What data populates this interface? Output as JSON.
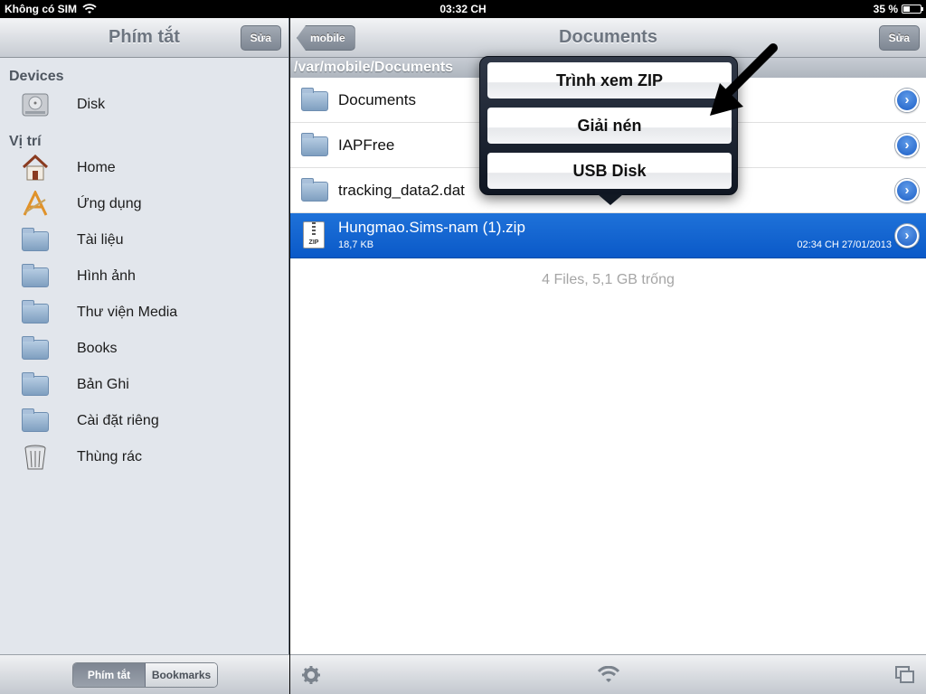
{
  "status_bar": {
    "carrier": "Không có SIM",
    "time": "03:32 CH",
    "battery": "35 %"
  },
  "left_panel": {
    "title": "Phím tắt",
    "edit_label": "Sửa",
    "sections": [
      {
        "header": "Devices",
        "items": [
          {
            "label": "Disk",
            "icon": "disk-icon"
          }
        ]
      },
      {
        "header": "Vị trí",
        "items": [
          {
            "label": "Home",
            "icon": "home-icon"
          },
          {
            "label": "Ứng dụng",
            "icon": "applications-icon"
          },
          {
            "label": "Tài liệu",
            "icon": "documents-folder-icon"
          },
          {
            "label": "Hình ảnh",
            "icon": "pictures-folder-icon"
          },
          {
            "label": "Thư viện Media",
            "icon": "music-folder-icon"
          },
          {
            "label": "Books",
            "icon": "folder-icon"
          },
          {
            "label": "Bản Ghi",
            "icon": "folder-icon"
          },
          {
            "label": "Cài đặt riêng",
            "icon": "folder-icon"
          },
          {
            "label": "Thùng rác",
            "icon": "trash-icon"
          }
        ]
      }
    ],
    "segments": [
      "Phím tắt",
      "Bookmarks"
    ],
    "active_segment": "Phím tắt"
  },
  "right_panel": {
    "back_label": "mobile",
    "title": "Documents",
    "edit_label": "Sửa",
    "path": "/var/mobile/Documents",
    "files": [
      {
        "name": "Documents",
        "type": "folder"
      },
      {
        "name": "IAPFree",
        "type": "folder"
      },
      {
        "name": "tracking_data2.dat",
        "type": "folder"
      },
      {
        "name": "Hungmao.Sims-nam (1).zip",
        "type": "zip",
        "size": "18,7 KB",
        "date": "02:34 CH 27/01/2013",
        "selected": true
      }
    ],
    "summary": "4 Files, 5,1 GB trống"
  },
  "popover": {
    "actions": [
      "Trình xem ZIP",
      "Giải nén",
      "USB Disk"
    ]
  },
  "colors": {
    "selection": "#1466d2",
    "accent": "#2a6fd0"
  }
}
